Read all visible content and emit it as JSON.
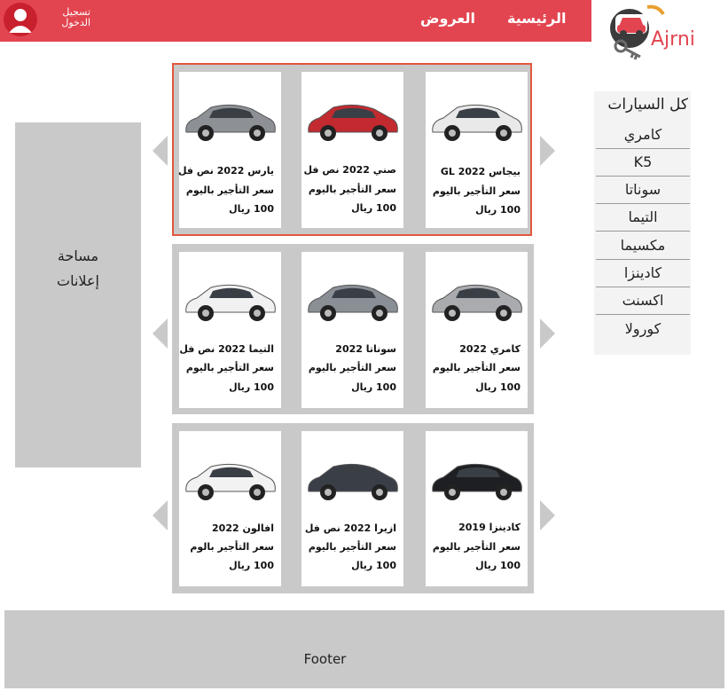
{
  "header": {
    "nav_home": "الرئيسية",
    "nav_offers": "العروض",
    "login": "تسجيل الدخول",
    "logo_text": "Ajrni",
    "brand_color": "#e24550"
  },
  "sidebar": {
    "title": "كل السيارات",
    "items": [
      {
        "label": "كامري"
      },
      {
        "label": "K5"
      },
      {
        "label": "سوناتا"
      },
      {
        "label": "التيما"
      },
      {
        "label": "مكسيما"
      },
      {
        "label": "كادينزا"
      },
      {
        "label": "اكسنت"
      },
      {
        "label": "كورولا"
      }
    ]
  },
  "ads": {
    "line1": "مساحة",
    "line2": "إعلانات"
  },
  "rows": [
    {
      "cards": [
        {
          "name": "بيجاس GL 2022",
          "price_label": "سعر التأجير باليوم",
          "price": "100 ريال",
          "car_color": "#e9e9e9"
        },
        {
          "name": "صني 2022 نص فل",
          "price_label": "سعر التأجير باليوم",
          "price": "100 ريال",
          "car_color": "#c22a30"
        },
        {
          "name": "يارس 2022 نص فل",
          "price_label": "سعر التأجير باليوم",
          "price": "100 ريال",
          "car_color": "#8d9196"
        }
      ]
    },
    {
      "cards": [
        {
          "name": "كامري 2022",
          "price_label": "سعر التأجير باليوم",
          "price": "100 ريال",
          "car_color": "#a9abae"
        },
        {
          "name": "سوناتا 2022",
          "price_label": "سعر التأجير باليوم",
          "price": "100 ريال",
          "car_color": "#8a8f95"
        },
        {
          "name": "التيما 2022 نص فل",
          "price_label": "سعر التأجير باليوم",
          "price": "100 ريال",
          "car_color": "#f1f1f1"
        }
      ]
    },
    {
      "cards": [
        {
          "name": "كادينزا 2019",
          "price_label": "سعر التأجير باليوم",
          "price": "100 ريال",
          "car_color": "#1e1f22"
        },
        {
          "name": "ازيرا 2022 نص فل",
          "price_label": "سعر التأجير باليوم",
          "price": "100 ريال",
          "car_color": "#3a3f47"
        },
        {
          "name": "افالون 2022",
          "price_label": "سعر التأجير بالوم",
          "price": "100 ريال",
          "car_color": "#f2f2f2"
        }
      ]
    }
  ],
  "footer": {
    "label": "Footer"
  }
}
